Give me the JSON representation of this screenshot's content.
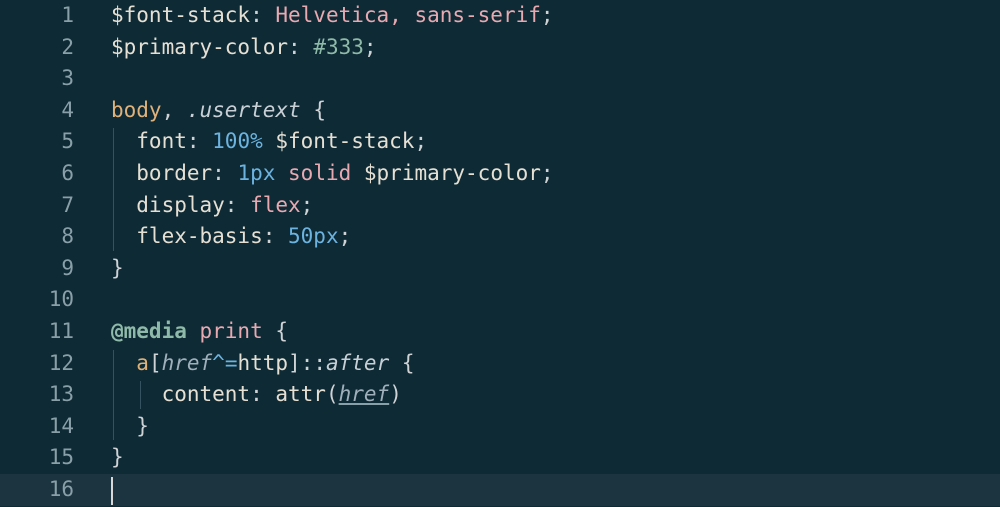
{
  "editor": {
    "colors": {
      "background": "#0e2a35",
      "active_line": "#1c3440",
      "line_number": "#8aa0a8"
    },
    "lines": [
      {
        "num": "1",
        "tokens": [
          [
            "sk",
            "$font-stack"
          ],
          [
            "pu",
            ": "
          ],
          [
            "st",
            "Helvetica, sans-serif"
          ],
          [
            "pu",
            ";"
          ]
        ]
      },
      {
        "num": "2",
        "tokens": [
          [
            "sk",
            "$primary-color"
          ],
          [
            "pu",
            ": "
          ],
          [
            "hx",
            "#333"
          ],
          [
            "pu",
            ";"
          ]
        ]
      },
      {
        "num": "3",
        "tokens": []
      },
      {
        "num": "4",
        "tokens": [
          [
            "tg",
            "body"
          ],
          [
            "pu",
            ", "
          ],
          [
            "it",
            ".usertext"
          ],
          [
            "pu",
            " {"
          ]
        ]
      },
      {
        "num": "5",
        "tokens": [
          [
            "pr",
            "  font"
          ],
          [
            "pu",
            ": "
          ],
          [
            "nu",
            "100%"
          ],
          [
            "sk",
            " $font-stack"
          ],
          [
            "pu",
            ";"
          ]
        ]
      },
      {
        "num": "6",
        "tokens": [
          [
            "pr",
            "  border"
          ],
          [
            "pu",
            ": "
          ],
          [
            "nu",
            "1px"
          ],
          [
            "kw",
            " solid"
          ],
          [
            "sk",
            " $primary-color"
          ],
          [
            "pu",
            ";"
          ]
        ]
      },
      {
        "num": "7",
        "tokens": [
          [
            "pr",
            "  display"
          ],
          [
            "pu",
            ": "
          ],
          [
            "kw",
            "flex"
          ],
          [
            "pu",
            ";"
          ]
        ]
      },
      {
        "num": "8",
        "tokens": [
          [
            "pr",
            "  flex-basis"
          ],
          [
            "pu",
            ": "
          ],
          [
            "nu",
            "50px"
          ],
          [
            "pu",
            ";"
          ]
        ]
      },
      {
        "num": "9",
        "tokens": [
          [
            "pu",
            "}"
          ]
        ]
      },
      {
        "num": "10",
        "tokens": []
      },
      {
        "num": "11",
        "tokens": [
          [
            "at",
            "@media"
          ],
          [
            "kw",
            " print"
          ],
          [
            "pu",
            " {"
          ]
        ]
      },
      {
        "num": "12",
        "tokens": [
          [
            "tg",
            "  a"
          ],
          [
            "pu",
            "["
          ],
          [
            "ai",
            "href"
          ],
          [
            "op",
            "^="
          ],
          [
            "sk",
            "http"
          ],
          [
            "pu",
            "]"
          ],
          [
            "pu",
            "::"
          ],
          [
            "it",
            "after"
          ],
          [
            "pu",
            " {"
          ]
        ]
      },
      {
        "num": "13",
        "tokens": [
          [
            "pr",
            "    content"
          ],
          [
            "pu",
            ": "
          ],
          [
            "sk",
            "attr"
          ],
          [
            "pu",
            "("
          ],
          [
            "ai ul",
            "href"
          ],
          [
            "pu",
            ")"
          ]
        ]
      },
      {
        "num": "14",
        "tokens": [
          [
            "pu",
            "  }"
          ]
        ]
      },
      {
        "num": "15",
        "tokens": [
          [
            "pu",
            "}"
          ]
        ]
      },
      {
        "num": "16",
        "tokens": []
      }
    ],
    "active_line": 16
  }
}
